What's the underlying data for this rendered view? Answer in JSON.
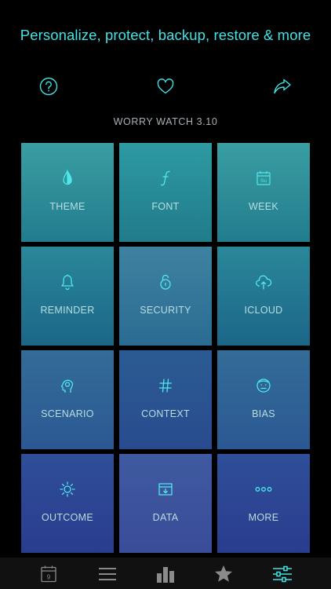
{
  "headline": "Personalize, protect, backup, restore & more",
  "version": "WORRY WATCH 3.10",
  "top_icons": [
    "help-icon",
    "heart-icon",
    "share-icon"
  ],
  "accent_color": "#3fe3e6",
  "tiles": [
    {
      "label": "THEME",
      "icon": "drop-icon"
    },
    {
      "label": "FONT",
      "icon": "font-icon"
    },
    {
      "label": "WEEK",
      "icon": "calendar-icon"
    },
    {
      "label": "REMINDER",
      "icon": "bell-icon"
    },
    {
      "label": "SECURITY",
      "icon": "lock-icon"
    },
    {
      "label": "ICLOUD",
      "icon": "cloud-icon"
    },
    {
      "label": "SCENARIO",
      "icon": "head-icon"
    },
    {
      "label": "CONTEXT",
      "icon": "hash-icon"
    },
    {
      "label": "BIAS",
      "icon": "face-icon"
    },
    {
      "label": "OUTCOME",
      "icon": "sun-icon"
    },
    {
      "label": "DATA",
      "icon": "archive-icon"
    },
    {
      "label": "MORE",
      "icon": "more-icon"
    }
  ],
  "week_icon_text": "Su",
  "tabbar": {
    "calendar_day": "9",
    "items": [
      "calendar-tab-icon",
      "list-tab-icon",
      "chart-tab-icon",
      "star-tab-icon",
      "settings-tab-icon"
    ]
  }
}
